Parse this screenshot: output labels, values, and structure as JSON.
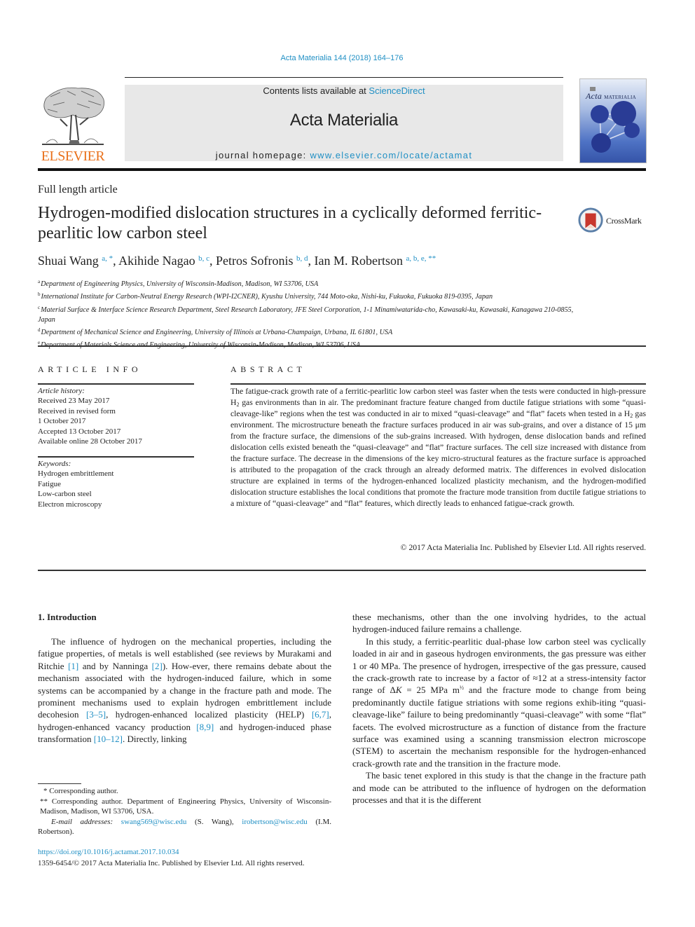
{
  "colors": {
    "link": "#1f8fc4",
    "elsevier_orange": "#e9711c",
    "masthead_bg": "#e8e8e8",
    "rule": "#111111"
  },
  "header": {
    "journal_ref": "Acta Materialia 144 (2018) 164–176",
    "publisher_wordmark": "ELSEVIER",
    "contents_prefix": "Contents lists available at ",
    "contents_link": "ScienceDirect",
    "journal_title": "Acta Materialia",
    "homepage_prefix": "journal homepage: ",
    "homepage_link": "www.elsevier.com/locate/actamat",
    "cover_title_italic": "Acta",
    "cover_title_caps": "MATERIALIA",
    "cover_icon": "journal-cover-molecule-graphic"
  },
  "article": {
    "type": "Full length article",
    "title": "Hydrogen-modified dislocation structures in a cyclically deformed ferritic-pearlitic low carbon steel",
    "crossmark_label": "CrossMark",
    "authors": [
      {
        "name": "Shuai Wang",
        "sup": "a, *",
        "sep": ", "
      },
      {
        "name": "Akihide Nagao",
        "sup": "b, c",
        "sep": ", "
      },
      {
        "name": "Petros Sofronis",
        "sup": "b, d",
        "sep": ", "
      },
      {
        "name": "Ian M. Robertson",
        "sup": "a, b, e, **",
        "sep": ""
      }
    ],
    "affiliations": [
      {
        "key": "a",
        "text": "Department of Engineering Physics, University of Wisconsin-Madison, Madison, WI 53706, USA"
      },
      {
        "key": "b",
        "text": "International Institute for Carbon-Neutral Energy Research (WPI-I2CNER), Kyushu University, 744 Moto-oka, Nishi-ku, Fukuoka, Fukuoka 819-0395, Japan"
      },
      {
        "key": "c",
        "text": "Material Surface & Interface Science Research Department, Steel Research Laboratory, JFE Steel Corporation, 1-1 Minamiwatarida-cho, Kawasaki-ku, Kawasaki, Kanagawa 210-0855, Japan"
      },
      {
        "key": "d",
        "text": "Department of Mechanical Science and Engineering, University of Illinois at Urbana-Champaign, Urbana, IL 61801, USA"
      },
      {
        "key": "e",
        "text": "Department of Materials Science and Engineering, University of Wisconsin-Madison, Madison, WI 53706, USA"
      }
    ]
  },
  "article_info": {
    "heading": "ARTICLE INFO",
    "history_label": "Article history:",
    "history": [
      "Received 23 May 2017",
      "Received in revised form",
      "1 October 2017",
      "Accepted 13 October 2017",
      "Available online 28 October 2017"
    ],
    "keywords_label": "Keywords:",
    "keywords": [
      "Hydrogen embrittlement",
      "Fatigue",
      "Low-carbon steel",
      "Electron microscopy"
    ]
  },
  "abstract": {
    "heading": "ABSTRACT",
    "parts": {
      "p1": "The fatigue-crack growth rate of a ferritic-pearlitic low carbon steel was faster when the tests were conducted in high-pressure H",
      "sub1": "2",
      "p2": " gas environments than in air. The predominant fracture feature changed from ductile fatigue striations with some “quasi-cleavage-like” regions when the test was conducted in air to mixed “quasi-cleavage” and “flat” facets when tested in a H",
      "sub2": "2",
      "p3": " gas environment. The microstructure beneath the fracture surfaces produced in air was sub-grains, and over a distance of 15 μm from the fracture surface, the dimensions of the sub-grains increased. With hydrogen, dense dislocation bands and refined dislocation cells existed beneath the “quasi-cleavage” and “flat” fracture surfaces. The cell size increased with distance from the fracture surface. The decrease in the dimensions of the key micro-structural features as the fracture surface is approached is attributed to the propagation of the crack through an already deformed matrix. The differences in evolved dislocation structure are explained in terms of the hydrogen-enhanced localized plasticity mechanism, and the hydrogen-modified dislocation structure establishes the local conditions that promote the fracture mode transition from ductile fatigue striations to a mixture of “quasi-cleavage” and “flat” features, which directly leads to enhanced fatigue-crack growth."
    },
    "copyright": "© 2017 Acta Materialia Inc. Published by Elsevier Ltd. All rights reserved."
  },
  "introduction": {
    "heading": "1.  Introduction",
    "left": {
      "t1": "The influence of hydrogen on the mechanical properties, including the fatigue properties, of metals is well established (see reviews by Murakami and Ritchie ",
      "c1": "[1]",
      "t2": " and by Nanninga ",
      "c2": "[2]",
      "t3": "). How-ever, there remains debate about the mechanism associated with the hydrogen-induced failure, which in some systems can be accompanied by a change in the fracture path and mode. The prominent mechanisms used to explain hydrogen embrittlement include decohesion ",
      "c3": "[3–5]",
      "t4": ", hydrogen-enhanced localized plasticity (HELP) ",
      "c4": "[6,7]",
      "t5": ", hydrogen-enhanced vacancy production ",
      "c5": "[8,9]",
      "t6": " and hydrogen-induced phase transformation ",
      "c6": "[10–12]",
      "t7": ". Directly, linking"
    },
    "right": {
      "p0": "these mechanisms, other than the one involving hydrides, to the actual hydrogen-induced failure remains a challenge.",
      "p1a": "In this study, a ferritic-pearlitic dual-phase low carbon steel was cyclically loaded in air and in gaseous hydrogen environments, the gas pressure was either 1 or 40 MPa. The presence of hydrogen, irrespective of the gas pressure, caused the crack-growth rate to increase by a factor of ≈12 at a stress-intensity factor range of Δ",
      "p1k": "K",
      "p1b": " = 25 MPa m",
      "p1sup": "½",
      "p1c": " and the fracture mode to change from being predominantly ductile fatigue striations with some regions exhib-iting “quasi-cleavage-like” failure to being predominantly “quasi-cleavage” with some “flat” facets. The evolved microstructure as a function of distance from the fracture surface was examined using a scanning transmission electron microscope (STEM) to ascertain the mechanism responsible for the hydrogen-enhanced crack-growth rate and the transition in the fracture mode.",
      "p2": "The basic tenet explored in this study is that the change in the fracture path and mode can be attributed to the influence of hydrogen on the deformation processes and that it is the different"
    }
  },
  "footnotes": {
    "f1": "* Corresponding author.",
    "f2": "** Corresponding author. Department of Engineering Physics, University of Wisconsin-Madison, Madison, WI 53706, USA.",
    "email_label": "E-mail addresses:",
    "email1": "swang569@wisc.edu",
    "email1_name": " (S. Wang), ",
    "email2": "irobertson@wisc.edu",
    "email2_name": " (I.M. Robertson).",
    "doi": "https://doi.org/10.1016/j.actamat.2017.10.034",
    "issn": "1359-6454/© 2017 Acta Materialia Inc. Published by Elsevier Ltd. All rights reserved."
  }
}
